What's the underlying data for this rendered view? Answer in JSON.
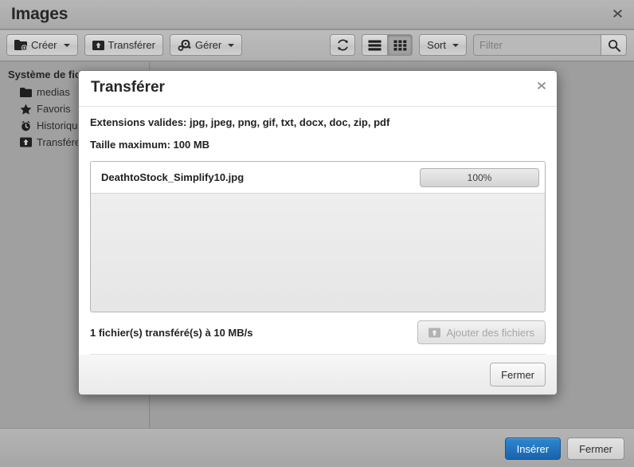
{
  "window": {
    "title": "Images",
    "close_label": "✖"
  },
  "toolbar": {
    "create_label": "Créer",
    "upload_label": "Transférer",
    "manage_label": "Gérer",
    "refresh_icon": "refresh-icon",
    "list_view_icon": "list-view-icon",
    "grid_view_icon": "grid-view-icon",
    "sort_label": "Sort",
    "filter_placeholder": "Filter",
    "filter_value": "",
    "search_icon": "search-icon"
  },
  "sidebar": {
    "heading": "Système de fichiers",
    "items": [
      {
        "label": "medias",
        "icon": "folder-icon"
      },
      {
        "label": "Favoris",
        "icon": "star-icon"
      },
      {
        "label": "Historique",
        "icon": "clock-icon"
      },
      {
        "label": "Transférer",
        "icon": "upload-icon"
      }
    ]
  },
  "modal": {
    "title": "Transférer",
    "close_label": "✖",
    "extensions_note": "Extensions valides: jpg, jpeg, png, gif, txt, docx, doc, zip, pdf",
    "maxsize_note": "Taille maximum: 100 MB",
    "files": [
      {
        "name": "DeathtoStock_Simplify10.jpg",
        "progress_label": "100%",
        "progress_value": 100
      }
    ],
    "status_text": "1 fichier(s) transféré(s) à 10 MB/s",
    "add_files_label": "Ajouter des fichiers",
    "add_files_icon": "upload-icon",
    "close_button_label": "Fermer"
  },
  "bottombar": {
    "insert_label": "Insérer",
    "close_label": "Fermer"
  },
  "colors": {
    "accent": "#1863ad",
    "window_bg": "#9a9a9a",
    "toolbar_bg": "#b4b4b4"
  }
}
